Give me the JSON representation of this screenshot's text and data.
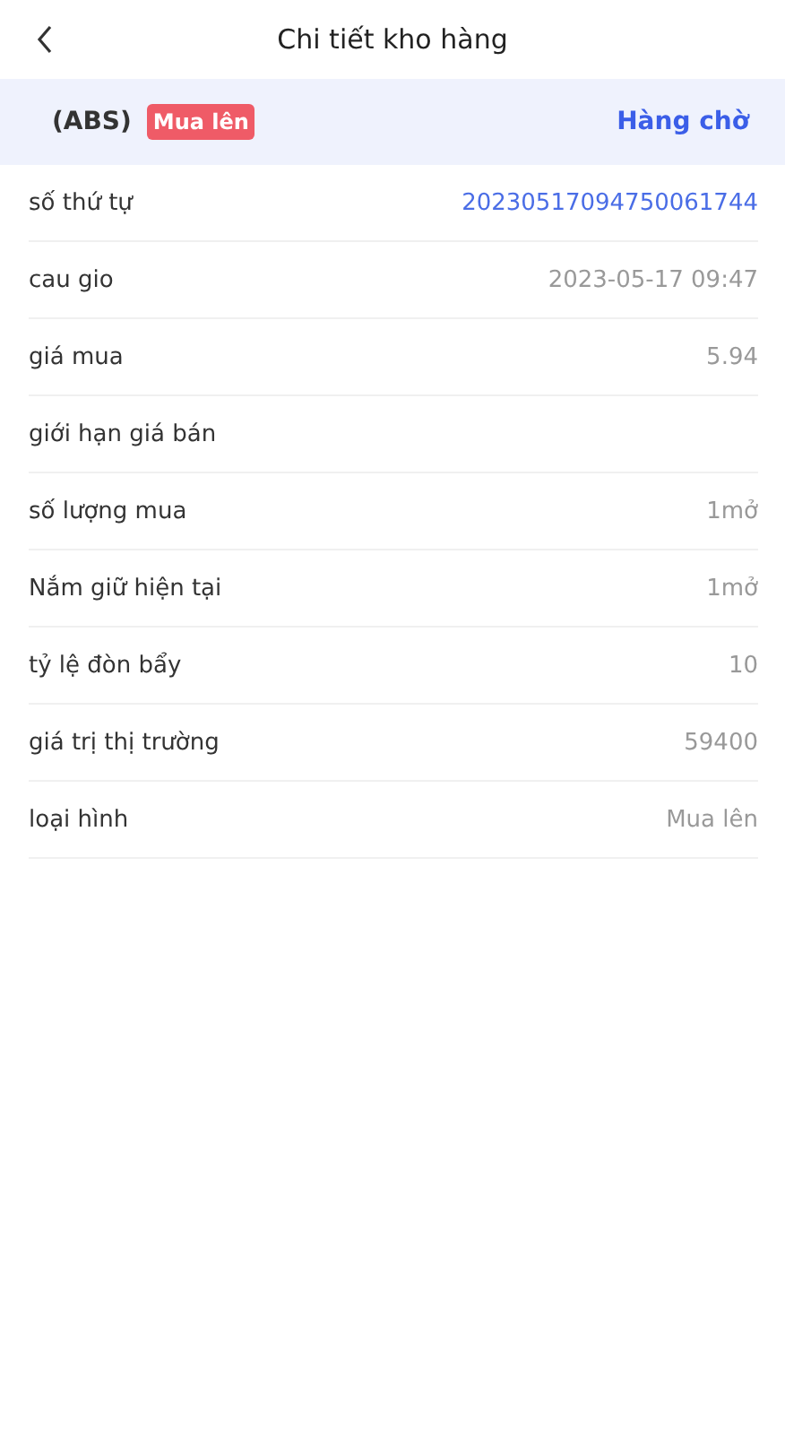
{
  "header": {
    "title": "Chi tiết kho hàng"
  },
  "summary": {
    "symbol": "(ABS)",
    "tag": "Mua lên",
    "status": "Hàng chờ"
  },
  "rows": [
    {
      "kind": "link",
      "label": "số thứ tự",
      "value": "20230517094750061744"
    },
    {
      "kind": "plain",
      "label": "cau gio",
      "value": "2023-05-17 09:47"
    },
    {
      "kind": "plain",
      "label": "giá mua",
      "value": "5.94"
    },
    {
      "label": "giới hạn giá bán"
    },
    {
      "kind": "plain",
      "label": "số lượng mua",
      "value": "1mở"
    },
    {
      "kind": "plain",
      "label": "Nắm giữ hiện tại",
      "value": "1mở"
    },
    {
      "kind": "plain",
      "label": "tỷ lệ đòn bẩy",
      "value": "10"
    },
    {
      "kind": "plain",
      "label": "giá trị thị trường",
      "value": "59400"
    },
    {
      "kind": "plain",
      "label": "loại hình",
      "value": "Mua lên"
    }
  ]
}
